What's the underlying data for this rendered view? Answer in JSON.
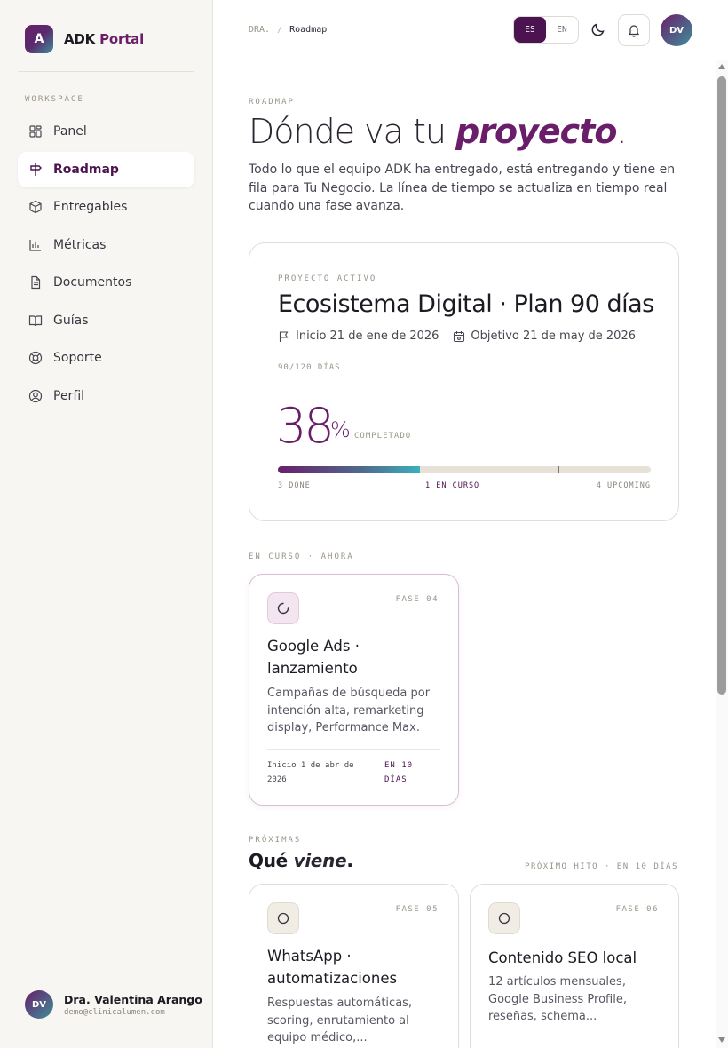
{
  "brand": {
    "logo_letter": "A",
    "name_main": "ADK",
    "name_accent": " Portal"
  },
  "sidebar": {
    "section_label": "WORKSPACE",
    "items": [
      {
        "label": "Panel",
        "icon": "grid-icon"
      },
      {
        "label": "Roadmap",
        "icon": "signpost-icon",
        "active": true
      },
      {
        "label": "Entregables",
        "icon": "box-icon"
      },
      {
        "label": "Métricas",
        "icon": "bar-chart-icon"
      },
      {
        "label": "Documentos",
        "icon": "document-icon"
      },
      {
        "label": "Guías",
        "icon": "book-icon"
      },
      {
        "label": "Soporte",
        "icon": "lifebuoy-icon"
      },
      {
        "label": "Perfil",
        "icon": "user-circle-icon"
      }
    ],
    "user": {
      "initials": "DV",
      "name": "Dra. Valentina Arango",
      "email": "demo@clinicalumen.com"
    }
  },
  "topbar": {
    "breadcrumb": [
      "DRA.",
      "Roadmap"
    ],
    "breadcrumb_sep": "/",
    "lang_es": "ES",
    "lang_en": "EN",
    "active_lang": "ES",
    "avatar_initials": "DV"
  },
  "hero": {
    "eyebrow": "ROADMAP",
    "title_plain": "Dónde va tu ",
    "title_em": "proyecto",
    "title_dot": ".",
    "description": "Todo lo que el equipo ADK ha entregado, está entregando y tiene en fila para Tu Negocio. La línea de tiempo se actualiza en tiempo real cuando una fase avanza."
  },
  "project": {
    "eyebrow": "PROYECTO ACTIVO",
    "title": "Ecosistema Digital · Plan 90 días",
    "start": "Inicio 21 de ene de 2026",
    "target": "Objetivo 21 de may de 2026",
    "days": "90/120 DÍAS",
    "percent": "38",
    "percent_sign": "%",
    "percent_label": "COMPLETADO",
    "progress_fraction": 0.38,
    "marker_fraction": 0.75,
    "done_label": "3 DONE",
    "current_label": "1 EN CURSO",
    "upcoming_label": "4 UPCOMING"
  },
  "current": {
    "section_label": "EN CURSO · AHORA",
    "card": {
      "phase": "FASE 04",
      "title": "Google Ads · lanzamiento",
      "description": "Campañas de búsqueda por intención alta, remarketing display, Performance Max.",
      "start": "Inicio 1 de abr de 2026",
      "eta": "EN 10 DÍAS"
    }
  },
  "upcoming": {
    "section_label": "PRÓXIMAS",
    "title_plain": "Qué ",
    "title_em": "viene",
    "title_dot": ".",
    "milestone": "PRÓXIMO HITO · EN 10 DÍAS",
    "cards": [
      {
        "phase": "FASE 05",
        "title": "WhatsApp · automatizaciones",
        "description": "Respuestas automáticas, scoring, enrutamiento al equipo médico,..."
      },
      {
        "phase": "FASE 06",
        "title": "Contenido SEO local",
        "description": "12 artículos mensuales, Google Business Profile, reseñas, schema..."
      }
    ]
  },
  "colors": {
    "accent": "#6a1e6a",
    "accent_dark": "#4b1450",
    "teal": "#3ab0bb",
    "sidebar_bg": "#f8f6f2"
  }
}
